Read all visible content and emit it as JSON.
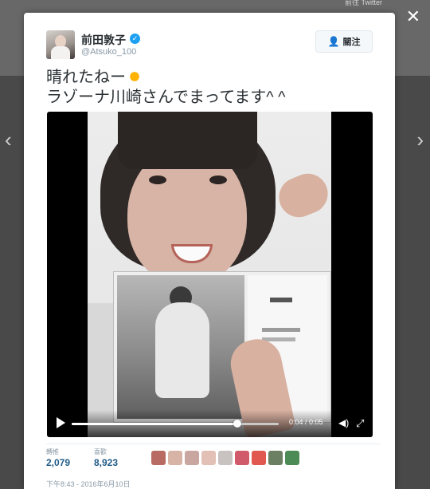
{
  "backdrop": {
    "top_link": "前往 Twitter"
  },
  "nav": {
    "prev": "‹",
    "next": "›"
  },
  "close": {
    "label": "✕"
  },
  "tweet": {
    "author": {
      "name": "前田敦子",
      "handle": "@Atsuko_100",
      "verified": true
    },
    "follow_button": {
      "label": "關注",
      "icon": "add-user-icon"
    },
    "text_lines": [
      "晴れたねー",
      "ラゾーナ川崎さんでまってます^ ^"
    ],
    "emoji": "sun-icon",
    "video": {
      "time": "0:04 / 0:05",
      "progress": 0.8
    },
    "stats": {
      "retweets_label": "轉推",
      "retweets": "2,079",
      "likes_label": "喜歡",
      "likes": "8,923"
    },
    "liker_colors": [
      "#b86b63",
      "#d7b4a6",
      "#c9a7a0",
      "#e2c0b6",
      "#c8c2c0",
      "#d05a6a",
      "#e0584f",
      "#6b7f63",
      "#4d8b56"
    ],
    "timestamp": "下午8:43 - 2016年6月10日"
  }
}
